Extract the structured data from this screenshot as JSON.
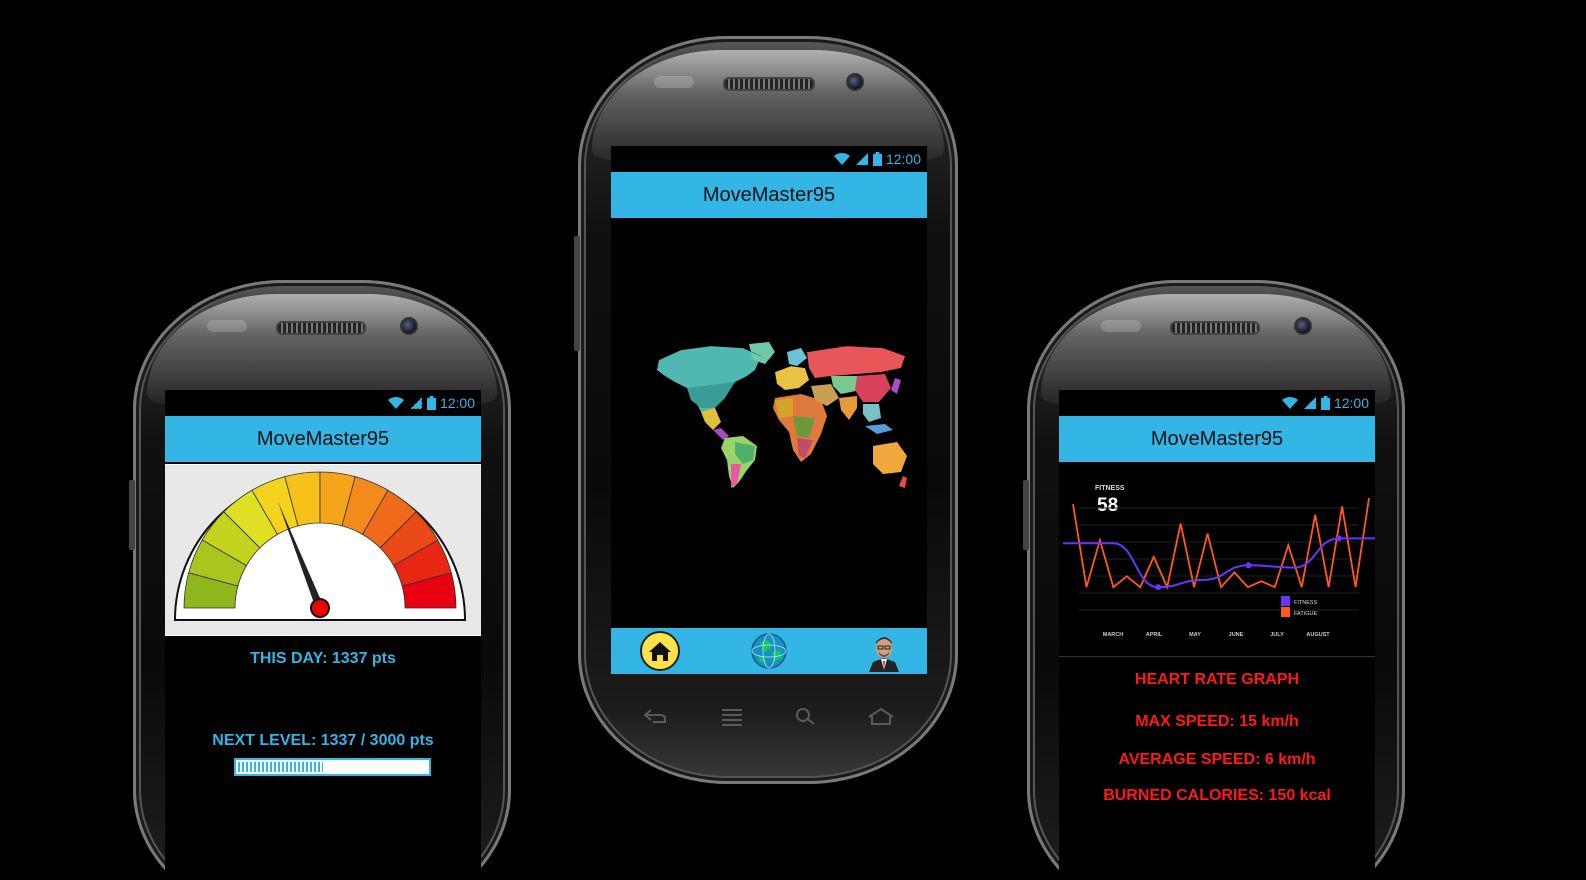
{
  "app": {
    "title": "MoveMaster95"
  },
  "status": {
    "time": "12:00"
  },
  "left_phone": {
    "this_day": "THIS DAY: 1337 pts",
    "next_level": "NEXT LEVEL: 1337 / 3000 pts",
    "progress_fraction": 0.45,
    "gauge_level_fraction": 0.38
  },
  "center_phone": {
    "nav": [
      "home-icon",
      "globe-icon",
      "profile-icon"
    ],
    "softkeys": [
      "back-icon",
      "menu-icon",
      "search-icon",
      "home-icon"
    ]
  },
  "right_phone": {
    "metric_label": "FITNESS",
    "metric_value": "58",
    "heart_rate_title": "HEART RATE GRAPH",
    "max_speed": "MAX SPEED: 15 km/h",
    "average_speed": "AVERAGE SPEED: 6 km/h",
    "burned_calories": "BURNED CALORIES: 150 kcal"
  },
  "chart_data": {
    "type": "line",
    "title": "",
    "categories": [
      "MARCH",
      "APRIL",
      "MAY",
      "JUNE",
      "JULY",
      "AUGUST"
    ],
    "legend_placement": "bottom-right",
    "grid": true,
    "series": [
      {
        "name": "FITNESS",
        "color": "#6a34ff",
        "values": [
          58,
          22,
          28,
          40,
          38,
          62
        ]
      },
      {
        "name": "FATIGUE",
        "color": "#ff5a1a",
        "values": [
          90,
          25,
          85,
          15,
          80,
          95
        ]
      }
    ]
  },
  "colors": {
    "accent": "#33b5e5",
    "alert": "#ff1a1a",
    "fitness": "#6a34ff",
    "fatigue": "#ff5a1a"
  }
}
